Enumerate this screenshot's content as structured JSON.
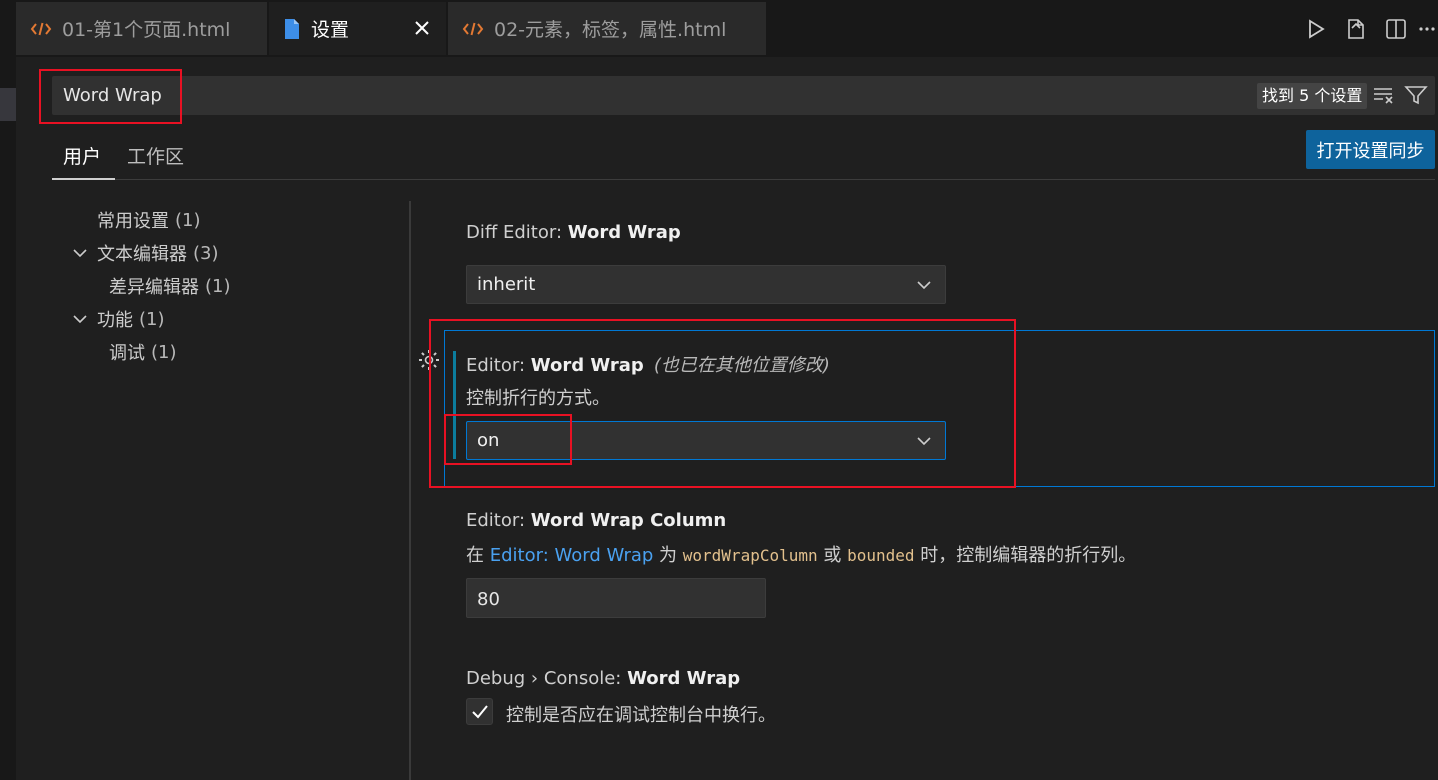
{
  "tabs": [
    {
      "label": "01-第1个页面.html",
      "icon": "code-icon",
      "active": false
    },
    {
      "label": "设置",
      "icon": "file-icon",
      "active": true
    },
    {
      "label": "02-元素，标签，属性.html",
      "icon": "code-icon",
      "active": false
    }
  ],
  "tab_actions": [
    "run-icon",
    "open-file-icon",
    "split-editor-icon",
    "more-icon"
  ],
  "search": {
    "value": "Word Wrap",
    "result_count": "找到 5 个设置"
  },
  "scope_tabs": [
    "用户",
    "工作区"
  ],
  "sync_button": "打开设置同步",
  "toc": [
    {
      "label": "常用设置",
      "count": "(1)",
      "expandable": false
    },
    {
      "label": "文本编辑器",
      "count": "(3)",
      "expandable": true
    },
    {
      "label": "差异编辑器",
      "count": "(1)",
      "expandable": false
    },
    {
      "label": "功能",
      "count": "(1)",
      "expandable": true
    },
    {
      "label": "调试",
      "count": "(1)",
      "expandable": false
    }
  ],
  "settings": {
    "diff": {
      "category": "Diff Editor: ",
      "name": "Word Wrap",
      "value": "inherit"
    },
    "editor": {
      "category": "Editor: ",
      "name": "Word Wrap",
      "modified": "(也已在其他位置修改)",
      "description": "控制折行的方式。",
      "value": "on"
    },
    "column": {
      "category": "Editor: ",
      "name": "Word Wrap Column",
      "desc_prefix": "在 ",
      "desc_link": "Editor: Word Wrap",
      "desc_mid1": " 为 ",
      "desc_code1": "wordWrapColumn",
      "desc_mid2": " 或 ",
      "desc_code2": "bounded",
      "desc_suffix": " 时，控制编辑器的折行列。",
      "value": "80"
    },
    "debug": {
      "category": "Debug › Console: ",
      "name": "Word Wrap",
      "description": "控制是否应在调试控制台中换行。",
      "checked": true
    }
  },
  "colors": {
    "accent": "#0078d4",
    "sync_button": "#0e639c",
    "highlight_box": "#e81123",
    "modified_bar": "#0c7d9d"
  }
}
